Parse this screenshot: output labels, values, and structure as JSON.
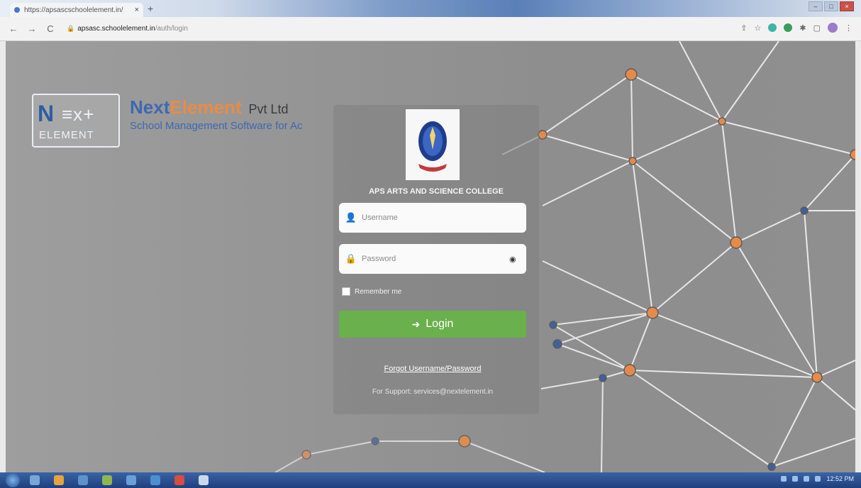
{
  "browser": {
    "tab_title": "https://apsascschoolelement.in/",
    "tab_close": "×",
    "new_tab": "+",
    "url_host": "apsasc.schoolelement.in",
    "url_path": "/auth/login",
    "nav_back": "←",
    "nav_forward": "→",
    "nav_reload": "C"
  },
  "brand": {
    "logo_n": "N",
    "logo_ext": "≡x+",
    "logo_word": "ELEMENT",
    "name_part1": "Next",
    "name_part2": "Element",
    "suffix": "Pvt Ltd",
    "tagline": "School Management Software for Ac"
  },
  "login": {
    "college_name": "APS ARTS AND SCIENCE COLLEGE",
    "username_placeholder": "Username",
    "password_placeholder": "Password",
    "remember_label": "Remember me",
    "login_label": "Login",
    "forgot_label": "Forgot Username/Password",
    "support_text": "For Support: services@nextelement.in"
  },
  "icons": {
    "user": "user-icon",
    "lock": "lock-icon",
    "eye": "eye-icon",
    "login_arrow": "sign-in-icon"
  },
  "taskbar": {
    "clock": "12:52 PM"
  },
  "colors": {
    "accent_green": "#6ab04c",
    "brand_blue": "#3e69b0",
    "brand_orange": "#e98b47"
  }
}
